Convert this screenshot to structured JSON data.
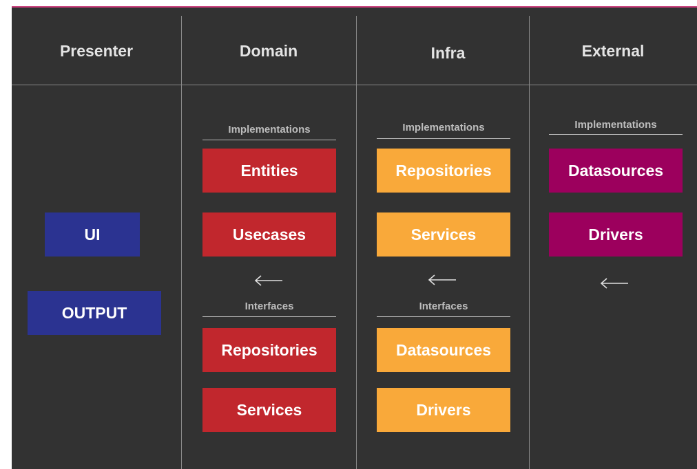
{
  "colors": {
    "background": "#323232",
    "domain_box": "#c1272d",
    "infra_box": "#f9a93a",
    "external_box": "#9c005d",
    "presenter_box": "#2b3391",
    "text": "#ffffff"
  },
  "columns": {
    "presenter": {
      "title": "Presenter",
      "boxes": [
        "UI",
        "OUTPUT"
      ]
    },
    "domain": {
      "title": "Domain",
      "implementations_label": "Implementations",
      "implementations": [
        "Entities",
        "Usecases"
      ],
      "interfaces_label": "Interfaces",
      "interfaces": [
        "Repositories",
        "Services"
      ]
    },
    "infra": {
      "title": "Infra",
      "implementations_label": "Implementations",
      "implementations": [
        "Repositories",
        "Services"
      ],
      "interfaces_label": "Interfaces",
      "interfaces": [
        "Datasources",
        "Drivers"
      ]
    },
    "external": {
      "title": "External",
      "implementations_label": "Implementations",
      "implementations": [
        "Datasources",
        "Drivers"
      ]
    }
  },
  "arrows": [
    {
      "name": "arrow-external-to-infra",
      "direction": "left"
    },
    {
      "name": "arrow-infra-to-domain",
      "direction": "left"
    },
    {
      "name": "arrow-domain-to-presenter",
      "direction": "left"
    }
  ]
}
